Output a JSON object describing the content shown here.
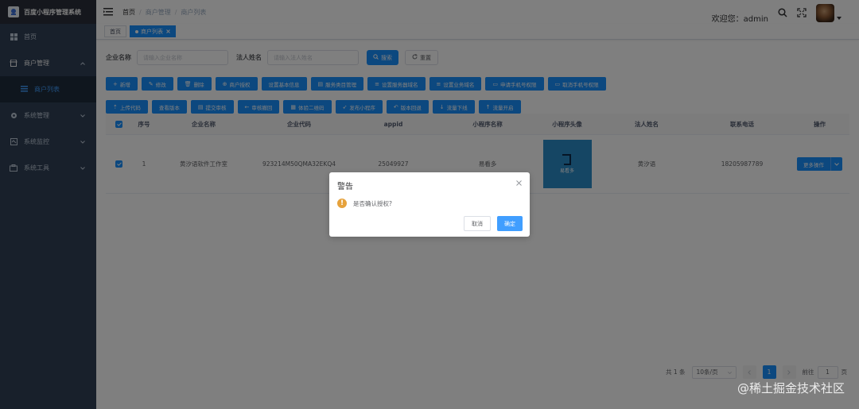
{
  "app": {
    "title": "百度小程序管理系统"
  },
  "sidebar": {
    "home": "首页",
    "merchant_mgmt": "商户管理",
    "merchant_list": "商户列表",
    "system_mgmt": "系统管理",
    "system_monitor": "系统监控",
    "system_tools": "系统工具"
  },
  "navbar": {
    "breadcrumb": [
      "首页",
      "商户管理",
      "商户列表"
    ],
    "welcome": "欢迎您：admin"
  },
  "tags": {
    "home": "首页",
    "current": "商户列表"
  },
  "search": {
    "company_label": "企业名称",
    "company_placeholder": "请输入企业名称",
    "legal_label": "法人姓名",
    "legal_placeholder": "请输入法人姓名",
    "search_btn": "搜索",
    "reset_btn": "重置"
  },
  "toolbar": {
    "row1": [
      {
        "icon": "+",
        "label": "新增"
      },
      {
        "icon": "✎",
        "label": "修改"
      },
      {
        "icon": "🗑",
        "label": "删除"
      },
      {
        "icon": "⊕",
        "label": "商户授权"
      },
      {
        "icon": "",
        "label": "设置基本信息"
      },
      {
        "icon": "▤",
        "label": "服务类目管理"
      },
      {
        "icon": "≡",
        "label": "设置服务器域名"
      },
      {
        "icon": "≡",
        "label": "设置业务域名"
      },
      {
        "icon": "▭",
        "label": "申请手机号权限"
      },
      {
        "icon": "▭",
        "label": "取消手机号权限"
      }
    ],
    "row2": [
      {
        "icon": "⇡",
        "label": "上传代码"
      },
      {
        "icon": "",
        "label": "查看版本"
      },
      {
        "icon": "▤",
        "label": "提交审核"
      },
      {
        "icon": "←",
        "label": "审核撤回"
      },
      {
        "icon": "▦",
        "label": "体验二维码"
      },
      {
        "icon": "➶",
        "label": "发布小程序"
      },
      {
        "icon": "↶",
        "label": "版本回退"
      },
      {
        "icon": "↓",
        "label": "流量下线"
      },
      {
        "icon": "↑",
        "label": "流量开启"
      }
    ]
  },
  "table": {
    "headers": [
      "序号",
      "企业名称",
      "企业代码",
      "appid",
      "小程序名称",
      "小程序头像",
      "法人姓名",
      "联系电话",
      "操作"
    ],
    "rows": [
      {
        "index": "1",
        "company": "黄汐语软件工作室",
        "code": "923214M50QMA32EKQ4",
        "appid": "25049927",
        "app_name": "易看多",
        "avatar_text": "易看多",
        "legal": "黄汐语",
        "phone": "18205987789",
        "action": "更多操作"
      }
    ]
  },
  "pagination": {
    "total": "共 1 条",
    "page_size": "10条/页",
    "current": "1",
    "goto_label": "前往",
    "goto_value": "1",
    "page_suffix": "页"
  },
  "dialog": {
    "title": "警告",
    "message": "是否确认授权?",
    "cancel": "取消",
    "confirm": "确定"
  },
  "watermark": "@稀土掘金技术社区",
  "colors": {
    "primary": "#1890ff",
    "sidebar": "#304156",
    "warning": "#e6a23c"
  }
}
